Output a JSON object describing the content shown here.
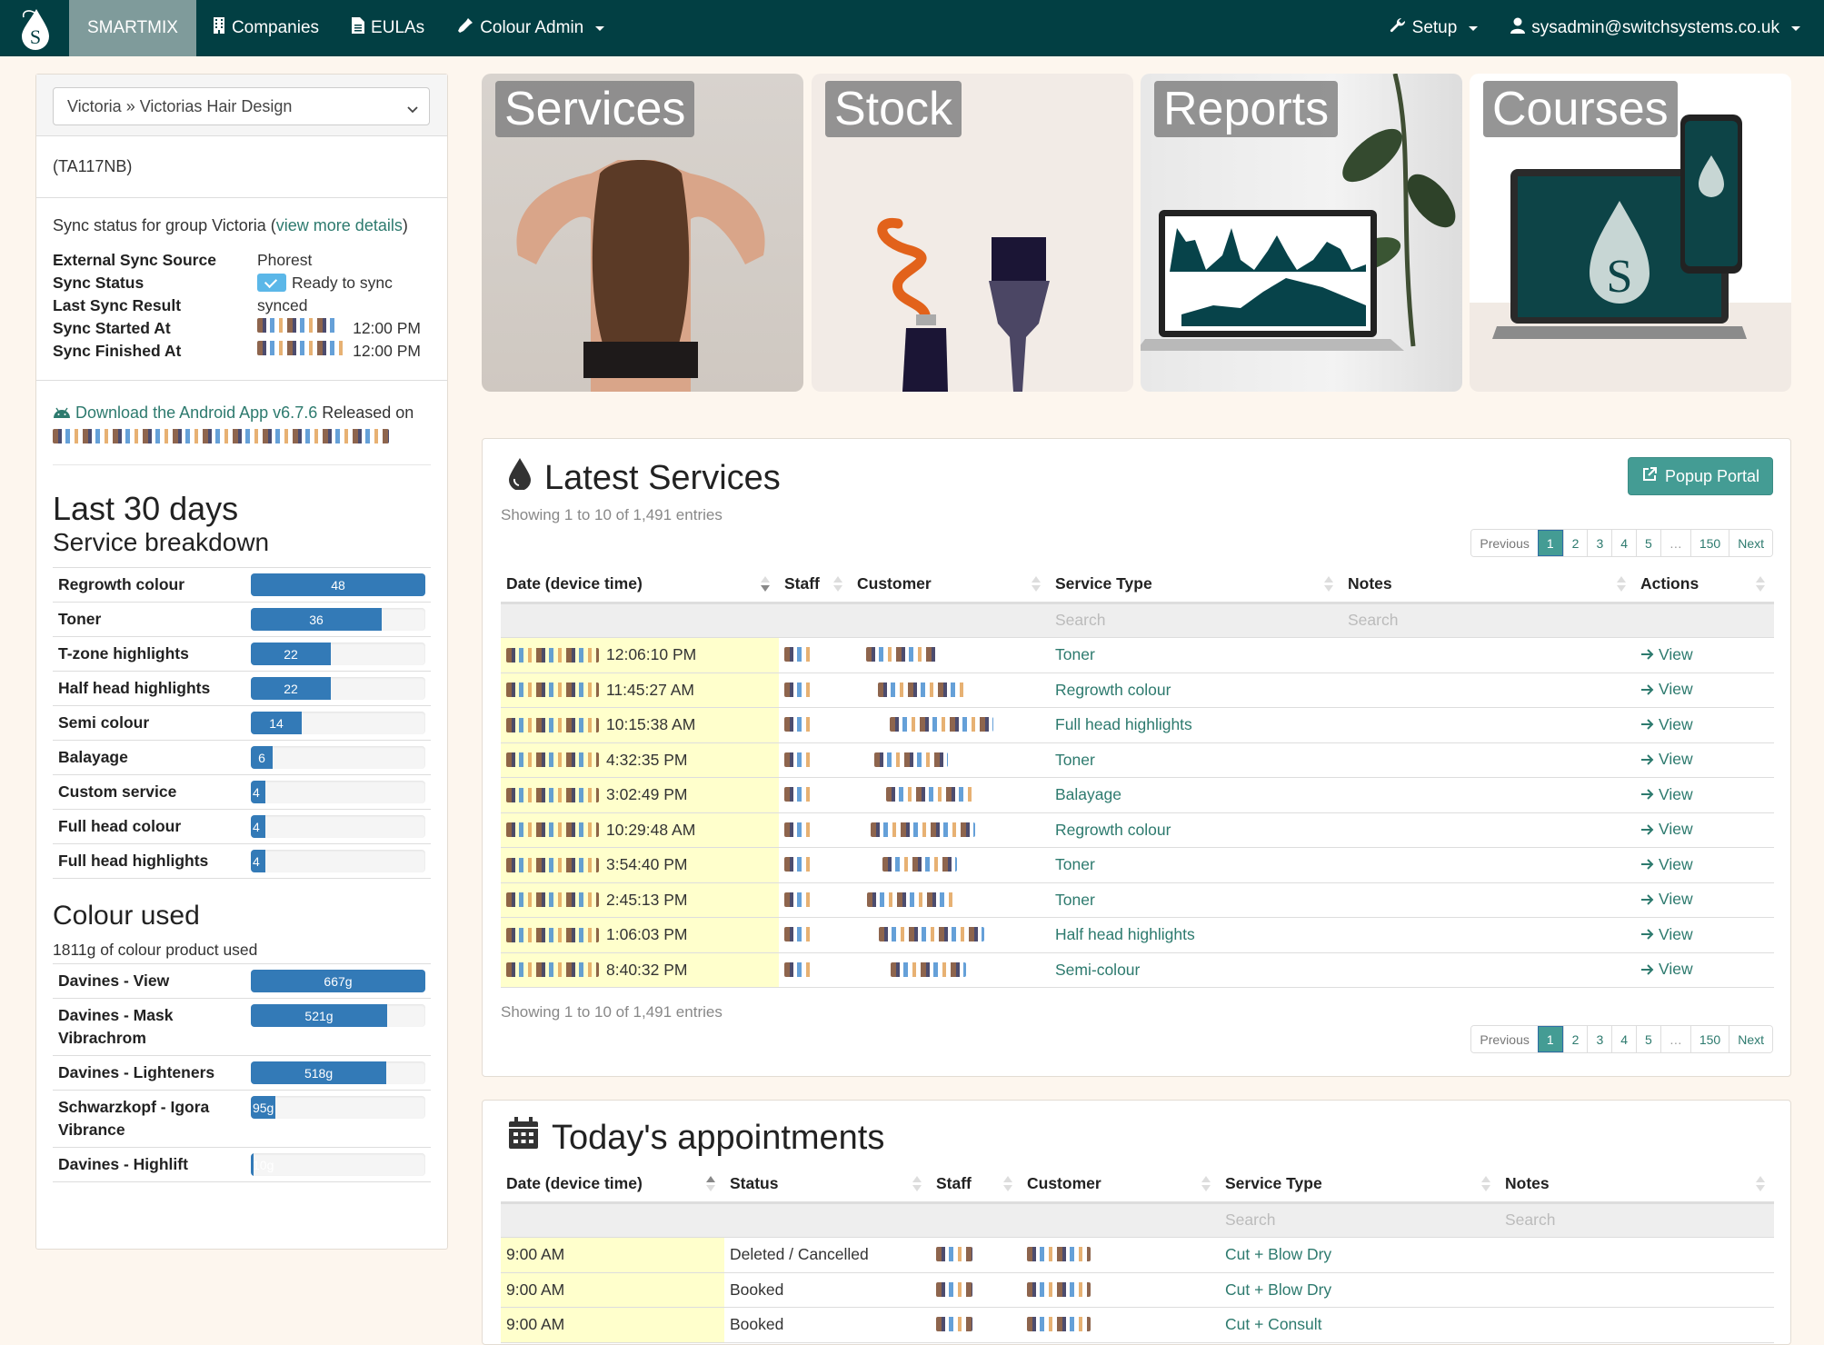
{
  "nav": {
    "brand": "SMARTMIX",
    "items": [
      {
        "label": "Companies",
        "icon": "building-icon"
      },
      {
        "label": "EULAs",
        "icon": "file-icon"
      },
      {
        "label": "Colour Admin",
        "icon": "eyedropper-icon",
        "dropdown": true
      }
    ],
    "setup": "Setup",
    "user": "sysadmin@switchsystems.co.uk"
  },
  "colors": {
    "navbar": "#023f43",
    "accent": "#449c94",
    "bar": "#337ab7",
    "highlight": "#ffffcc",
    "link": "#2d7a6e"
  },
  "left": {
    "salon_select": "Victoria » Victorias Hair Design",
    "postcode": "(TA117NB)",
    "sync": {
      "title_prefix": "Sync status for group Victoria (",
      "title_link": "view more details",
      "title_suffix": ")",
      "rows": [
        {
          "key": "External Sync Source",
          "value": "Phorest"
        },
        {
          "key": "Sync Status",
          "value": "Ready to sync"
        },
        {
          "key": "Last Sync Result",
          "value": "synced"
        },
        {
          "key": "Sync Started At",
          "value": "12:00 PM"
        },
        {
          "key": "Sync Finished At",
          "value": "12:00 PM"
        }
      ]
    },
    "android": {
      "link": "Download the Android App v6.7.6",
      "suffix": " Released on"
    },
    "heading": "Last 30 days",
    "subheading": "Service breakdown",
    "services": [
      {
        "label": "Regrowth colour",
        "value": 48,
        "display": "48"
      },
      {
        "label": "Toner",
        "value": 36,
        "display": "36"
      },
      {
        "label": "T-zone highlights",
        "value": 22,
        "display": "22"
      },
      {
        "label": "Half head highlights",
        "value": 22,
        "display": "22"
      },
      {
        "label": "Semi colour",
        "value": 14,
        "display": "14"
      },
      {
        "label": "Balayage",
        "value": 6,
        "display": "6"
      },
      {
        "label": "Custom service",
        "value": 4,
        "display": "4"
      },
      {
        "label": "Full head colour",
        "value": 4,
        "display": "4"
      },
      {
        "label": "Full head highlights",
        "value": 4,
        "display": "4"
      }
    ],
    "colour_heading": "Colour used",
    "colour_total": "1811g of colour product used",
    "colours": [
      {
        "label": "Davines - View",
        "value": 667,
        "display": "667g"
      },
      {
        "label": "Davines - Mask Vibrachrom",
        "value": 521,
        "display": "521g"
      },
      {
        "label": "Davines - Lighteners",
        "value": 518,
        "display": "518g"
      },
      {
        "label": "Schwarzkopf - Igora Vibrance",
        "value": 95,
        "display": "95g"
      },
      {
        "label": "Davines - Highlift",
        "value": 10,
        "display": "10g"
      }
    ]
  },
  "tiles": [
    {
      "label": "Services"
    },
    {
      "label": "Stock"
    },
    {
      "label": "Reports"
    },
    {
      "label": "Courses"
    }
  ],
  "latest": {
    "title": "Latest Services",
    "info": "Showing 1 to 10 of 1,491 entries",
    "popup": "Popup Portal",
    "pager": [
      "Previous",
      "1",
      "2",
      "3",
      "4",
      "5",
      "…",
      "150",
      "Next"
    ],
    "columns": [
      "Date (device time)",
      "Staff",
      "Customer",
      "Service Type",
      "Notes",
      "Actions"
    ],
    "search_placeholder": "Search",
    "view_label": "View",
    "rows": [
      {
        "time": "12:06:10 PM",
        "service": "Toner"
      },
      {
        "time": "11:45:27 AM",
        "service": "Regrowth colour"
      },
      {
        "time": "10:15:38 AM",
        "service": "Full head highlights"
      },
      {
        "time": "4:32:35 PM",
        "service": "Toner"
      },
      {
        "time": "3:02:49 PM",
        "service": "Balayage"
      },
      {
        "time": "10:29:48 AM",
        "service": "Regrowth colour"
      },
      {
        "time": "3:54:40 PM",
        "service": "Toner"
      },
      {
        "time": "2:45:13 PM",
        "service": "Toner"
      },
      {
        "time": "1:06:03 PM",
        "service": "Half head highlights"
      },
      {
        "time": "8:40:32 PM",
        "service": "Semi-colour"
      }
    ]
  },
  "appointments": {
    "title": "Today's appointments",
    "columns": [
      "Date (device time)",
      "Status",
      "Staff",
      "Customer",
      "Service Type",
      "Notes"
    ],
    "search_placeholder": "Search",
    "rows": [
      {
        "time": "9:00 AM",
        "status": "Deleted / Cancelled",
        "service": "Cut + Blow Dry"
      },
      {
        "time": "9:00 AM",
        "status": "Booked",
        "service": "Cut + Blow Dry"
      },
      {
        "time": "9:00 AM",
        "status": "Booked",
        "service": "Cut + Consult"
      }
    ]
  }
}
